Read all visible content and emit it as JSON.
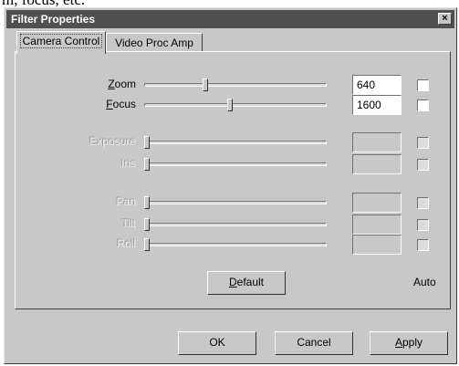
{
  "caption": "m, focus, etc.",
  "window": {
    "title": "Filter Properties",
    "close_glyph": "×"
  },
  "tabs": [
    {
      "label": "Camera Control",
      "active": true
    },
    {
      "label": "Video Proc Amp",
      "active": false
    }
  ],
  "controls": [
    {
      "label": "Zoom",
      "access_key": "Z",
      "label_rest": "oom",
      "value": "640",
      "level": 0.33,
      "enabled": true,
      "auto": false
    },
    {
      "label": "Focus",
      "access_key": "F",
      "label_rest": "ocus",
      "value": "1600",
      "level": 0.47,
      "enabled": true,
      "auto": false
    },
    {
      "label": "Exposure",
      "access_key": "",
      "label_rest": "Exposure",
      "value": "",
      "level": 0.0,
      "enabled": false,
      "auto": false
    },
    {
      "label": "Iris",
      "access_key": "",
      "label_rest": "Iris",
      "value": "",
      "level": 0.0,
      "enabled": false,
      "auto": false
    },
    {
      "label": "Pan",
      "access_key": "",
      "label_rest": "Pan",
      "value": "",
      "level": 0.0,
      "enabled": false,
      "auto": false
    },
    {
      "label": "Tilt",
      "access_key": "",
      "label_rest": "Tilt",
      "value": "",
      "level": 0.0,
      "enabled": false,
      "auto": false
    },
    {
      "label": "Roll",
      "access_key": "",
      "label_rest": "Roll",
      "value": "",
      "level": 0.0,
      "enabled": false,
      "auto": false
    }
  ],
  "default_button": {
    "access_key": "D",
    "label_rest": "efault"
  },
  "auto_label": "Auto",
  "footer_buttons": {
    "ok": "OK",
    "cancel": "Cancel",
    "apply_access_key": "A",
    "apply_rest": "pply"
  }
}
